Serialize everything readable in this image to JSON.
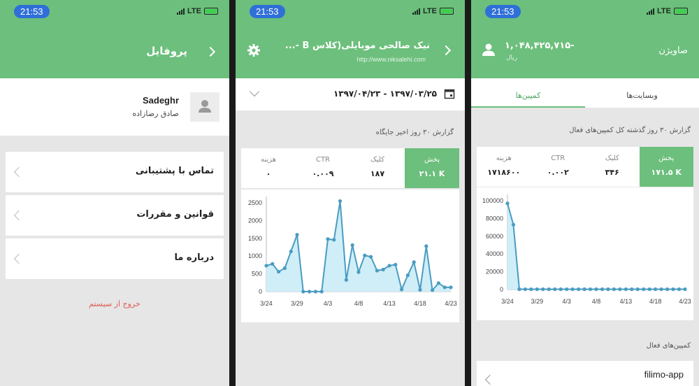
{
  "status": {
    "time": "21:53",
    "network": "LTE"
  },
  "profile_screen": {
    "title": "پروفایل",
    "username": "Sadeghr",
    "fullname": "صادق رضازاده",
    "menu": [
      {
        "label": "تماس با پشتیبانی"
      },
      {
        "label": "قوانین و مقررات"
      },
      {
        "label": "درباره ما"
      }
    ],
    "logout": "خروج از سیستم"
  },
  "site_screen": {
    "title": "نیک صالحی موبایلی(کلاس B -...",
    "url": "http://www.niksalehi.com",
    "date_range": "۱۳۹۷/۰۴/۲۳ - ۱۳۹۷/۰۳/۲۵",
    "report_title": "گزارش ۳۰ روز اخیر جایگاه",
    "stats": [
      {
        "label": "پخش",
        "value": "۲۱.۱ K"
      },
      {
        "label": "کلیک",
        "value": "۱۸۷"
      },
      {
        "label": "CTR",
        "value": "۰.۰۰۹"
      },
      {
        "label": "هزینه",
        "value": "۰"
      }
    ]
  },
  "campaign_screen": {
    "balance": "۱,۰۴۸,۴۲۵,۷۱۵-",
    "currency": "ریال",
    "title": "صاویژن",
    "tabs": [
      {
        "label": "وبسایت‌ها"
      },
      {
        "label": "کمپین‌ها"
      }
    ],
    "report_title": "گزارش ۳۰ روز گذشته کل کمپین‌های فعال",
    "stats": [
      {
        "label": "پخش",
        "value": "۱۷۱.۵ K"
      },
      {
        "label": "کلیک",
        "value": "۳۴۶"
      },
      {
        "label": "CTR",
        "value": "۰.۰۰۲"
      },
      {
        "label": "هزینه",
        "value": "۱۷۱۸۶۰۰"
      }
    ],
    "active_campaigns_title": "کمپین‌های فعال",
    "campaign_item": "filimo-app"
  },
  "chart_data": [
    {
      "type": "area",
      "x": [
        "3/24",
        "3/25",
        "3/26",
        "3/27",
        "3/28",
        "3/29",
        "3/30",
        "3/31",
        "4/1",
        "4/2",
        "4/3",
        "4/4",
        "4/5",
        "4/6",
        "4/7",
        "4/8",
        "4/9",
        "4/10",
        "4/11",
        "4/12",
        "4/13",
        "4/14",
        "4/15",
        "4/16",
        "4/17",
        "4/18",
        "4/19",
        "4/20",
        "4/21",
        "4/22",
        "4/23"
      ],
      "tick_labels": [
        "3/24",
        "3/29",
        "4/3",
        "4/8",
        "4/13",
        "4/18",
        "4/23"
      ],
      "values": [
        730,
        780,
        560,
        660,
        1130,
        1600,
        0,
        0,
        0,
        0,
        1480,
        1460,
        2550,
        330,
        1310,
        550,
        1020,
        980,
        590,
        620,
        730,
        760,
        60,
        460,
        830,
        50,
        1280,
        40,
        240,
        120,
        120
      ],
      "yticks": [
        0,
        500,
        1000,
        1500,
        2000,
        2500
      ],
      "ylim": [
        0,
        2600
      ],
      "color": "#4a9cc0",
      "fill": "#cfeef8"
    },
    {
      "type": "area",
      "x": [
        "3/24",
        "3/25",
        "3/26",
        "3/27",
        "3/28",
        "3/29",
        "3/30",
        "3/31",
        "4/1",
        "4/2",
        "4/3",
        "4/4",
        "4/5",
        "4/6",
        "4/7",
        "4/8",
        "4/9",
        "4/10",
        "4/11",
        "4/12",
        "4/13",
        "4/14",
        "4/15",
        "4/16",
        "4/17",
        "4/18",
        "4/19",
        "4/20",
        "4/21",
        "4/22",
        "4/23"
      ],
      "tick_labels": [
        "3/24",
        "3/29",
        "4/3",
        "4/8",
        "4/13",
        "4/18",
        "4/23"
      ],
      "values": [
        97000,
        73000,
        300,
        300,
        300,
        300,
        300,
        300,
        300,
        300,
        300,
        300,
        300,
        300,
        300,
        300,
        300,
        300,
        300,
        300,
        300,
        300,
        300,
        300,
        300,
        300,
        300,
        300,
        300,
        300,
        300
      ],
      "yticks": [
        0,
        20000,
        40000,
        60000,
        80000,
        100000
      ],
      "ylim": [
        0,
        104000
      ],
      "color": "#4a9cc0",
      "fill": "#cfeef8"
    }
  ]
}
